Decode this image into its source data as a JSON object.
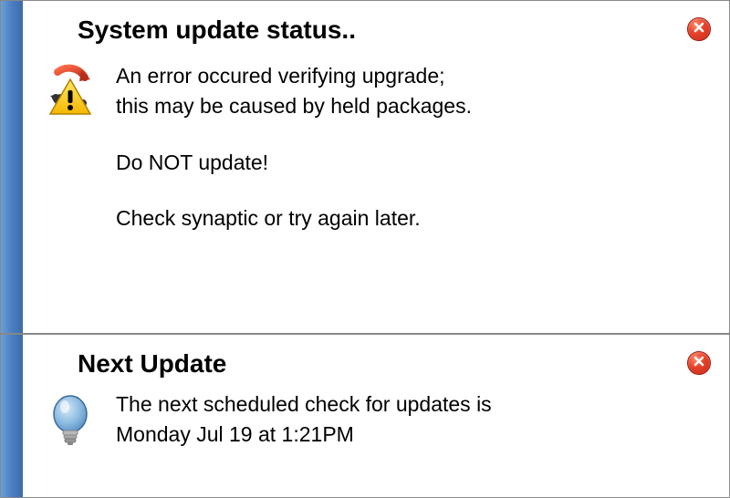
{
  "notifications": [
    {
      "title": "System update status..",
      "icon": "warning-refresh",
      "paragraphs": [
        "An error occured verifying upgrade;\nthis may be caused by held packages.",
        "Do NOT update!",
        "Check synaptic or try again later."
      ]
    },
    {
      "title": "Next Update",
      "icon": "lightbulb",
      "paragraphs": [
        "The next scheduled check for updates is\nMonday Jul 19 at 1:21PM"
      ]
    }
  ],
  "colors": {
    "stripe": "#4a7fc2",
    "close": "#e8432b"
  }
}
